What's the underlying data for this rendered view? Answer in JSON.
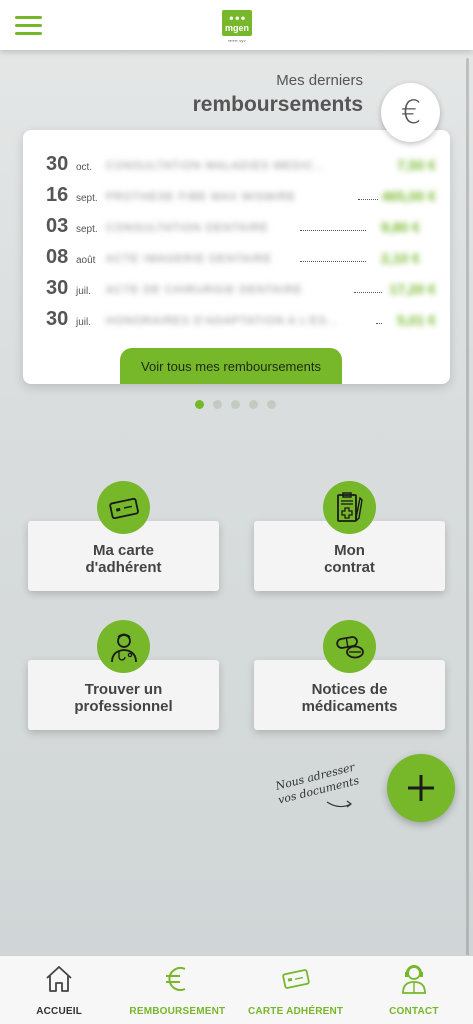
{
  "header": {
    "menu_icon": "hamburger-icon",
    "logo": {
      "main": "mgen",
      "figures": "☻☻☻",
      "sub": "▪▪▪▪▪▪ vyv"
    }
  },
  "reimbursements": {
    "subtitle": "Mes derniers",
    "title": "remboursements",
    "badge_icon": "euro-icon",
    "badge_symbol": "€",
    "rows": [
      {
        "day": "30",
        "month": "oct.",
        "label": "CONSULTATION MALADIES MEDIC...",
        "amount": "7,50 €"
      },
      {
        "day": "16",
        "month": "sept.",
        "label": "PROTHESE FIBE MAX MISMIRE",
        "amount": "465,00 €"
      },
      {
        "day": "03",
        "month": "sept.",
        "label": "CONSULTATION DENTAIRE",
        "amount": "9,80 €"
      },
      {
        "day": "08",
        "month": "août",
        "label": "ACTE IMAGERIE DENTAIRE",
        "amount": "2,10 €"
      },
      {
        "day": "30",
        "month": "juil.",
        "label": "ACTE DE CHIRURGIE DENTAIRE",
        "amount": "17,20 €"
      },
      {
        "day": "30",
        "month": "juil.",
        "label": "HONORAIRES D'ADAPTATION A L'ES...",
        "amount": "5,01 €"
      }
    ],
    "see_all_label": "Voir tous mes remboursements",
    "pager": {
      "count": 5,
      "active": 0
    }
  },
  "tiles": [
    {
      "id": "carte",
      "label": "Ma carte\nd'adhérent",
      "icon": "card-icon"
    },
    {
      "id": "contrat",
      "label": "Mon\ncontrat",
      "icon": "contract-icon"
    },
    {
      "id": "pro",
      "label": "Trouver un\nprofessionnel",
      "icon": "doctor-icon"
    },
    {
      "id": "notices",
      "label": "Notices de\nmédicaments",
      "icon": "pills-icon"
    }
  ],
  "documents_note": "Nous adresser\nvos documents",
  "fab_icon": "plus-icon",
  "bottom_nav": [
    {
      "label": "ACCUEIL",
      "icon": "home-icon",
      "color": "dark"
    },
    {
      "label": "REMBOURSEMENT",
      "icon": "euro-icon",
      "color": "green"
    },
    {
      "label": "CARTE ADHÉRENT",
      "icon": "card-icon",
      "color": "green"
    },
    {
      "label": "CONTACT",
      "icon": "agent-icon",
      "color": "green"
    }
  ],
  "colors": {
    "accent": "#76b82a",
    "text": "#444444"
  }
}
